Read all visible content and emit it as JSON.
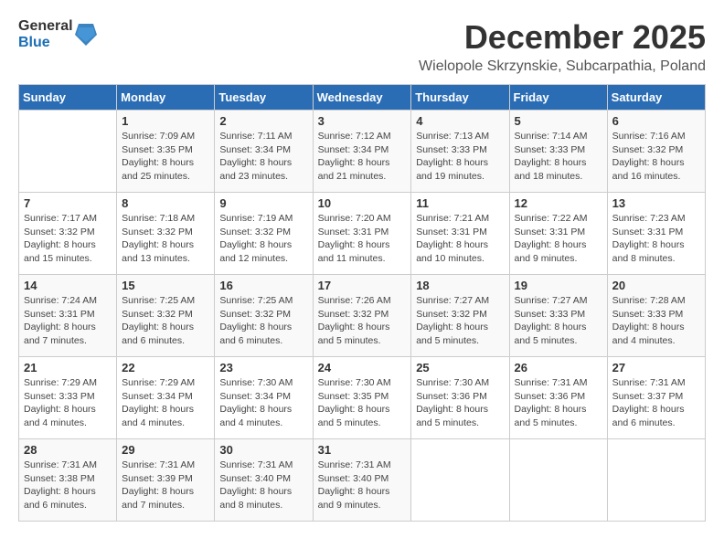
{
  "header": {
    "logo_general": "General",
    "logo_blue": "Blue",
    "month_title": "December 2025",
    "location": "Wielopole Skrzynskie, Subcarpathia, Poland"
  },
  "weekdays": [
    "Sunday",
    "Monday",
    "Tuesday",
    "Wednesday",
    "Thursday",
    "Friday",
    "Saturday"
  ],
  "weeks": [
    [
      {
        "day": "",
        "info": ""
      },
      {
        "day": "1",
        "info": "Sunrise: 7:09 AM\nSunset: 3:35 PM\nDaylight: 8 hours\nand 25 minutes."
      },
      {
        "day": "2",
        "info": "Sunrise: 7:11 AM\nSunset: 3:34 PM\nDaylight: 8 hours\nand 23 minutes."
      },
      {
        "day": "3",
        "info": "Sunrise: 7:12 AM\nSunset: 3:34 PM\nDaylight: 8 hours\nand 21 minutes."
      },
      {
        "day": "4",
        "info": "Sunrise: 7:13 AM\nSunset: 3:33 PM\nDaylight: 8 hours\nand 19 minutes."
      },
      {
        "day": "5",
        "info": "Sunrise: 7:14 AM\nSunset: 3:33 PM\nDaylight: 8 hours\nand 18 minutes."
      },
      {
        "day": "6",
        "info": "Sunrise: 7:16 AM\nSunset: 3:32 PM\nDaylight: 8 hours\nand 16 minutes."
      }
    ],
    [
      {
        "day": "7",
        "info": "Sunrise: 7:17 AM\nSunset: 3:32 PM\nDaylight: 8 hours\nand 15 minutes."
      },
      {
        "day": "8",
        "info": "Sunrise: 7:18 AM\nSunset: 3:32 PM\nDaylight: 8 hours\nand 13 minutes."
      },
      {
        "day": "9",
        "info": "Sunrise: 7:19 AM\nSunset: 3:32 PM\nDaylight: 8 hours\nand 12 minutes."
      },
      {
        "day": "10",
        "info": "Sunrise: 7:20 AM\nSunset: 3:31 PM\nDaylight: 8 hours\nand 11 minutes."
      },
      {
        "day": "11",
        "info": "Sunrise: 7:21 AM\nSunset: 3:31 PM\nDaylight: 8 hours\nand 10 minutes."
      },
      {
        "day": "12",
        "info": "Sunrise: 7:22 AM\nSunset: 3:31 PM\nDaylight: 8 hours\nand 9 minutes."
      },
      {
        "day": "13",
        "info": "Sunrise: 7:23 AM\nSunset: 3:31 PM\nDaylight: 8 hours\nand 8 minutes."
      }
    ],
    [
      {
        "day": "14",
        "info": "Sunrise: 7:24 AM\nSunset: 3:31 PM\nDaylight: 8 hours\nand 7 minutes."
      },
      {
        "day": "15",
        "info": "Sunrise: 7:25 AM\nSunset: 3:32 PM\nDaylight: 8 hours\nand 6 minutes."
      },
      {
        "day": "16",
        "info": "Sunrise: 7:25 AM\nSunset: 3:32 PM\nDaylight: 8 hours\nand 6 minutes."
      },
      {
        "day": "17",
        "info": "Sunrise: 7:26 AM\nSunset: 3:32 PM\nDaylight: 8 hours\nand 5 minutes."
      },
      {
        "day": "18",
        "info": "Sunrise: 7:27 AM\nSunset: 3:32 PM\nDaylight: 8 hours\nand 5 minutes."
      },
      {
        "day": "19",
        "info": "Sunrise: 7:27 AM\nSunset: 3:33 PM\nDaylight: 8 hours\nand 5 minutes."
      },
      {
        "day": "20",
        "info": "Sunrise: 7:28 AM\nSunset: 3:33 PM\nDaylight: 8 hours\nand 4 minutes."
      }
    ],
    [
      {
        "day": "21",
        "info": "Sunrise: 7:29 AM\nSunset: 3:33 PM\nDaylight: 8 hours\nand 4 minutes."
      },
      {
        "day": "22",
        "info": "Sunrise: 7:29 AM\nSunset: 3:34 PM\nDaylight: 8 hours\nand 4 minutes."
      },
      {
        "day": "23",
        "info": "Sunrise: 7:30 AM\nSunset: 3:34 PM\nDaylight: 8 hours\nand 4 minutes."
      },
      {
        "day": "24",
        "info": "Sunrise: 7:30 AM\nSunset: 3:35 PM\nDaylight: 8 hours\nand 5 minutes."
      },
      {
        "day": "25",
        "info": "Sunrise: 7:30 AM\nSunset: 3:36 PM\nDaylight: 8 hours\nand 5 minutes."
      },
      {
        "day": "26",
        "info": "Sunrise: 7:31 AM\nSunset: 3:36 PM\nDaylight: 8 hours\nand 5 minutes."
      },
      {
        "day": "27",
        "info": "Sunrise: 7:31 AM\nSunset: 3:37 PM\nDaylight: 8 hours\nand 6 minutes."
      }
    ],
    [
      {
        "day": "28",
        "info": "Sunrise: 7:31 AM\nSunset: 3:38 PM\nDaylight: 8 hours\nand 6 minutes."
      },
      {
        "day": "29",
        "info": "Sunrise: 7:31 AM\nSunset: 3:39 PM\nDaylight: 8 hours\nand 7 minutes."
      },
      {
        "day": "30",
        "info": "Sunrise: 7:31 AM\nSunset: 3:40 PM\nDaylight: 8 hours\nand 8 minutes."
      },
      {
        "day": "31",
        "info": "Sunrise: 7:31 AM\nSunset: 3:40 PM\nDaylight: 8 hours\nand 9 minutes."
      },
      {
        "day": "",
        "info": ""
      },
      {
        "day": "",
        "info": ""
      },
      {
        "day": "",
        "info": ""
      }
    ]
  ]
}
